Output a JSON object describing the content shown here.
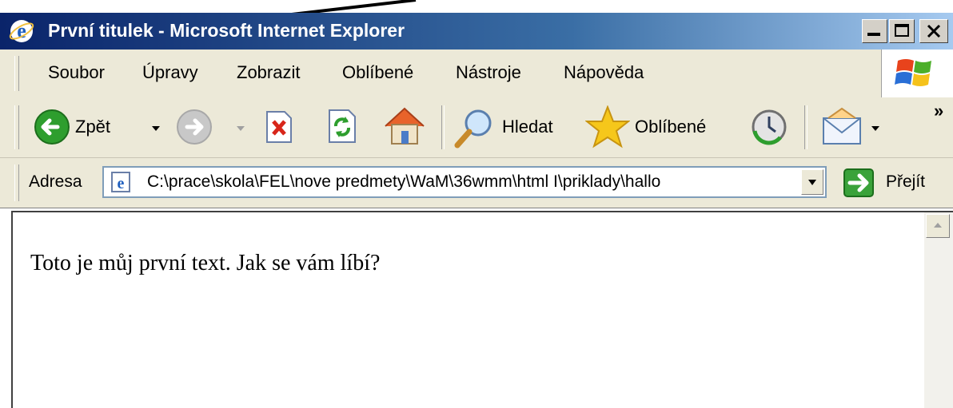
{
  "window": {
    "title": "První titulek - Microsoft Internet Explorer",
    "min_glyph": "_",
    "max_glyph": "□",
    "close_glyph": "✕"
  },
  "menu": {
    "items": [
      {
        "label": "Soubor"
      },
      {
        "label": "Úpravy"
      },
      {
        "label": "Zobrazit"
      },
      {
        "label": "Oblíbené"
      },
      {
        "label": "Nástroje"
      },
      {
        "label": "Nápověda"
      }
    ]
  },
  "toolbar": {
    "back_label": "Zpět",
    "search_label": "Hledat",
    "favorites_label": "Oblíbené",
    "more_glyph": "»"
  },
  "address": {
    "label": "Adresa",
    "value": "C:\\prace\\skola\\FEL\\nove predmety\\WaM\\36wmm\\html I\\priklady\\hallo",
    "go_label": "Přejít"
  },
  "content": {
    "text": "Toto je můj první text. Jak se vám líbí?"
  },
  "colors": {
    "titlebar": "#0a246a",
    "chrome": "#ece9d8",
    "back_green": "#2e9e2e",
    "go_green": "#3aa23a"
  }
}
